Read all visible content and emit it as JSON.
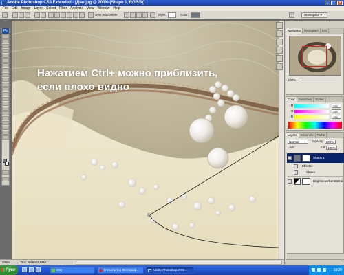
{
  "window": {
    "title": "Adobe Photoshop CS3 Extended - [Дно.jpg @ 200% (Shape 1, RGB/8)]",
    "controls": [
      "_",
      "□",
      "x"
    ]
  },
  "menu": [
    "File",
    "Edit",
    "Image",
    "Layer",
    "Select",
    "Filter",
    "Analysis",
    "View",
    "Window",
    "Help"
  ],
  "options_bar": {
    "auto_add_delete": "Auto Add/Delete",
    "style_label": "Style:",
    "color_label": "Color:",
    "workspace": "Workspace ▾"
  },
  "canvas": {
    "overlay_text_line1": "Нажатием Ctrl+ можно приблизить,",
    "overlay_text_line2": "если плохо видно"
  },
  "status": {
    "zoom": "200%",
    "doc_info": "Doc: 4,66M/4,66M"
  },
  "navigator": {
    "tabs": [
      "Navigator",
      "Histogram",
      "Info"
    ],
    "zoom": "200%"
  },
  "color_panel": {
    "tabs": [
      "Color",
      "Swatches",
      "Styles"
    ],
    "channels": [
      {
        "label": "R",
        "value": "255"
      },
      {
        "label": "G",
        "value": "255"
      },
      {
        "label": "B",
        "value": "255"
      }
    ]
  },
  "layers_panel": {
    "tabs": [
      "Layers",
      "Channels",
      "Paths"
    ],
    "blend_mode": "Normal",
    "opacity_label": "Opacity:",
    "opacity": "100%",
    "lock_label": "Lock:",
    "fill_label": "Fill:",
    "fill": "100%",
    "layers": [
      {
        "name": "Shape 1",
        "selected": true
      },
      {
        "name": "Effects",
        "selected": false
      },
      {
        "name": "Stroke",
        "selected": false
      },
      {
        "name": "Brightness/Contrast 1",
        "selected": false
      }
    ]
  },
  "taskbar": {
    "start": "Пуск",
    "tasks": [
      {
        "label": "ICQ",
        "active": false
      },
      {
        "label": "В Контакте | Фотограф...",
        "active": false
      },
      {
        "label": "Adobe Photoshop CS3 ...",
        "active": true
      }
    ],
    "clock": "18:20"
  },
  "colors": {
    "title_bar": "#1b3fa6",
    "taskbar": "#245ad8",
    "start": "#2f8a2f",
    "selected_layer": "#0a246a",
    "nav_rect": "#e02020"
  }
}
